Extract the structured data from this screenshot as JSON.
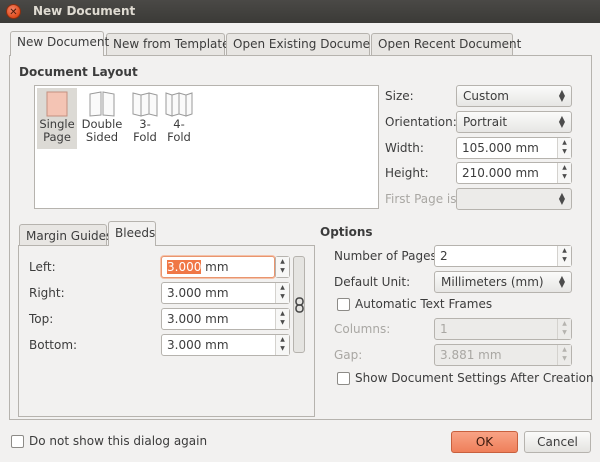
{
  "window": {
    "title": "New Document"
  },
  "tabs": [
    {
      "label": "New Document"
    },
    {
      "label": "New from Template"
    },
    {
      "label": "Open Existing Document"
    },
    {
      "label": "Open Recent Document"
    }
  ],
  "document_layout": {
    "title": "Document Layout",
    "items": [
      {
        "label": "Single\nPage",
        "selected": true
      },
      {
        "label": "Double\nSided"
      },
      {
        "label": "3-\nFold"
      },
      {
        "label": "4-\nFold"
      }
    ]
  },
  "page_settings": {
    "size_label": "Size:",
    "size_value": "Custom",
    "orientation_label": "Orientation:",
    "orientation_value": "Portrait",
    "width_label": "Width:",
    "width_value": "105.000 mm",
    "height_label": "Height:",
    "height_value": "210.000 mm",
    "first_page_label": "First Page is:",
    "first_page_value": ""
  },
  "margin_tabs": [
    {
      "label": "Margin Guides"
    },
    {
      "label": "Bleeds"
    }
  ],
  "bleeds": {
    "left_label": "Left:",
    "left_value_selected": "3.000",
    "left_value_unit": " mm",
    "right_label": "Right:",
    "right_value": "3.000 mm",
    "top_label": "Top:",
    "top_value": "3.000 mm",
    "bottom_label": "Bottom:",
    "bottom_value": "3.000 mm"
  },
  "options": {
    "title": "Options",
    "pages_label": "Number of Pages:",
    "pages_value": "2",
    "unit_label": "Default Unit:",
    "unit_value": "Millimeters (mm)",
    "auto_frames_label": "Automatic Text Frames",
    "columns_label": "Columns:",
    "columns_value": "1",
    "gap_label": "Gap:",
    "gap_value": "3.881 mm",
    "show_settings_label": "Show Document Settings After Creation"
  },
  "footer": {
    "dont_show_label": "Do not show this dialog again",
    "ok_label": "OK",
    "cancel_label": "Cancel"
  },
  "colors": {
    "accent": "#ef7f5a",
    "titlebar": "#3b3a37",
    "background": "#f2f1f0"
  }
}
